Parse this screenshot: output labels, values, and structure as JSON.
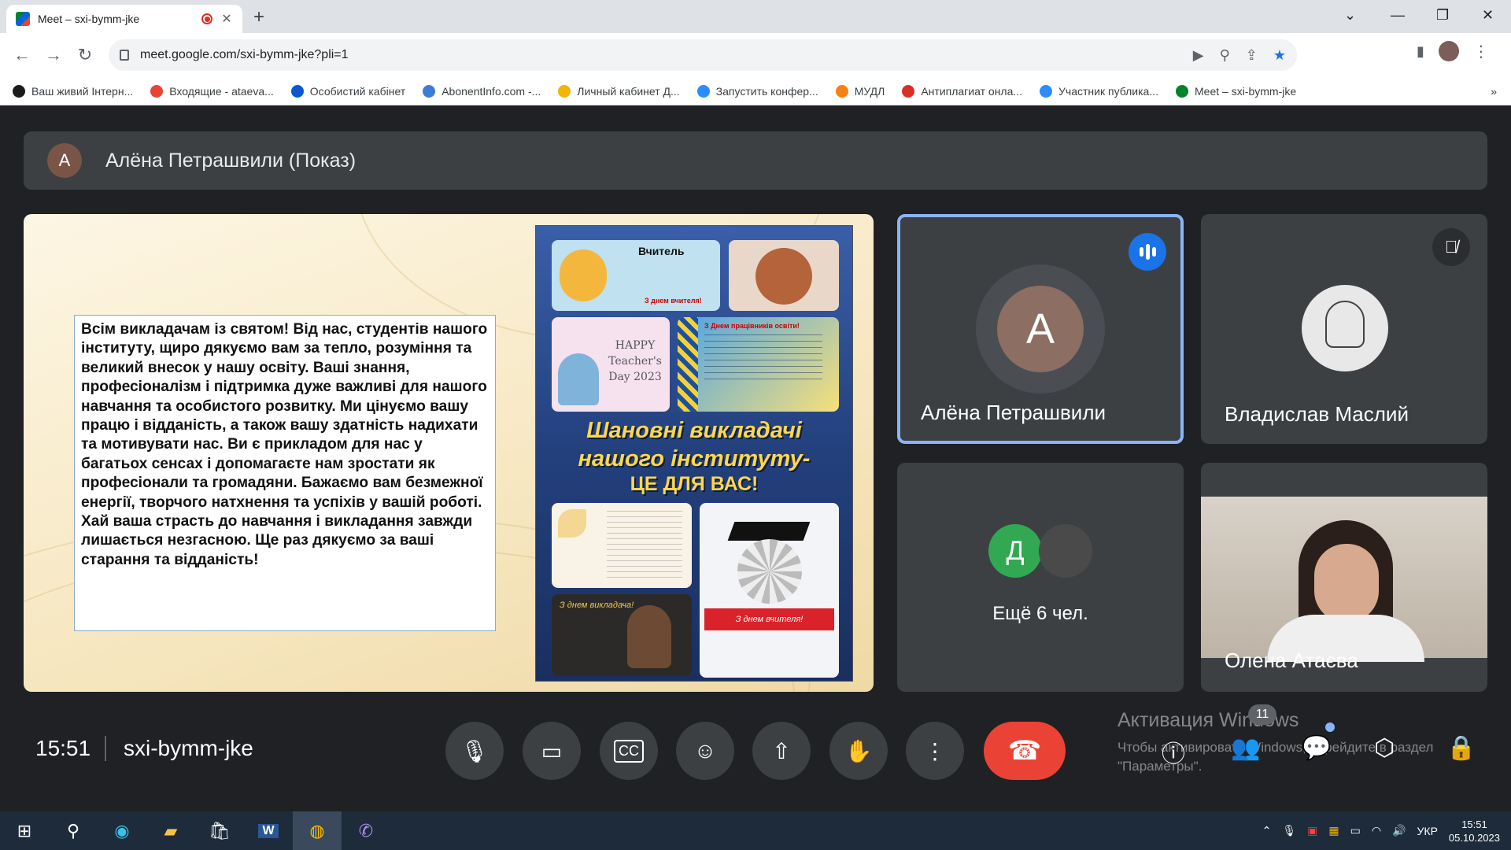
{
  "browser": {
    "tab_title": "Meet – sxi-bymm-jke",
    "url": "meet.google.com/sxi-bymm-jke?pli=1",
    "bookmarks": [
      {
        "label": "Ваш живий Інтерн...",
        "color": "#1b1b1b"
      },
      {
        "label": "Входящие - ataeva...",
        "color": "#ea4335"
      },
      {
        "label": "Особистий кабінет",
        "color": "#0b57d0"
      },
      {
        "label": "AbonentInfo.com -...",
        "color": "#3d7bd9"
      },
      {
        "label": "Личный кабинет Д...",
        "color": "#f4b400"
      },
      {
        "label": "Запустить конфер...",
        "color": "#2d8cff"
      },
      {
        "label": "МУДЛ",
        "color": "#f98012"
      },
      {
        "label": "Антиплагиат онла...",
        "color": "#d93025"
      },
      {
        "label": "Участник публика...",
        "color": "#2d8cff"
      },
      {
        "label": "Meet – sxi-bymm-jke",
        "color": "#00832d"
      }
    ]
  },
  "meet": {
    "presenter_initial": "А",
    "presenter_title": "Алёна Петрашвили (Показ)",
    "slide": {
      "text": "Всім викладачам із святом! Від нас, студентів нашого інституту, щиро дякуємо вам за тепло, розуміння та великий внесок у нашу освіту. Ваші знання, професіоналізм і підтримка дуже важливі для нашого навчання та особистого розвитку. Ми цінуємо вашу працю і відданість, а також вашу здатність надихати та мотивувати нас. Ви є прикладом для нас у багатьох сенсах і допомагаєте нам зростати як професіонали та громадяни. Бажаємо вам безмежної енергії, творчого натхнення та успіхів у вашій роботі. Хай ваша страсть до навчання і викладання завжди лишається незгасною. Ще раз дякуємо за ваші старання та відданість!",
      "poster_title_1": "Шановні викладачі",
      "poster_title_2": "нашого інституту-",
      "poster_title_3": "ЦЕ ДЛЯ ВАС!",
      "card1_title": "Вчитель",
      "card1_footer": "З днем вчителя!",
      "card3_text": "HAPPY Teacher's Day 2023",
      "card4_title": "З Днем працівників освіти!",
      "card7_text": "З днем викладача!",
      "card8_text": "З днем вчителя!"
    },
    "participants": [
      {
        "name": "Алёна Петрашвили",
        "initial": "А",
        "speaking": true
      },
      {
        "name": "Владислав Маслий",
        "muted": true
      },
      {
        "initial": "Д",
        "more_label": "Ещё 6 чел."
      },
      {
        "name": "Олена Атаєва"
      }
    ],
    "time": "15:51",
    "meeting_code": "sxi-bymm-jke",
    "people_count": "11"
  },
  "watermark": {
    "line1": "Активация Windows",
    "line2": "Чтобы активировать Windows, перейдите в раздел",
    "line3": "\"Параметры\"."
  },
  "taskbar": {
    "lang": "УКР",
    "time": "15:51",
    "date": "05.10.2023"
  }
}
